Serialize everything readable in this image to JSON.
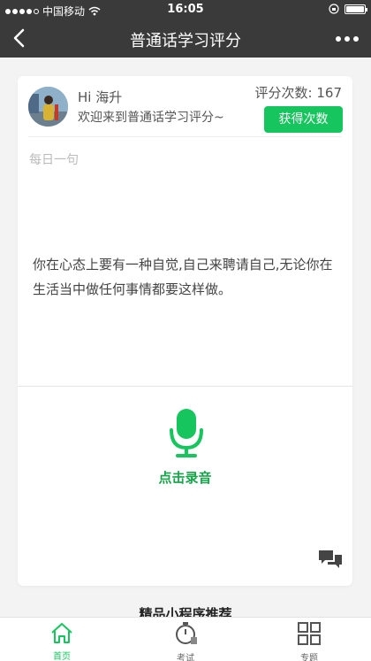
{
  "status": {
    "carrier": "中国移动",
    "time": "16:05"
  },
  "navbar": {
    "title": "普通话学习评分"
  },
  "header": {
    "greeting": "Hi  海升",
    "welcome": "欢迎来到普通话学习评分~",
    "count_text": "评分次数: 167",
    "get_button": "获得次数"
  },
  "daily": {
    "label": "每日一句",
    "quote": "你在心态上要有一种自觉,自己来聘请自己,无论你在生活当中做任何事情都要这样做。"
  },
  "record": {
    "label": "点击录音"
  },
  "below": {
    "title": "精品小程序推荐"
  },
  "tabs": [
    {
      "label": "首页",
      "icon": "home-icon",
      "active": true
    },
    {
      "label": "考试",
      "icon": "stopwatch-icon",
      "active": false
    },
    {
      "label": "专题",
      "icon": "grid-icon",
      "active": false
    }
  ],
  "colors": {
    "accent": "#16c55d",
    "navbar": "#3a3a3a"
  }
}
